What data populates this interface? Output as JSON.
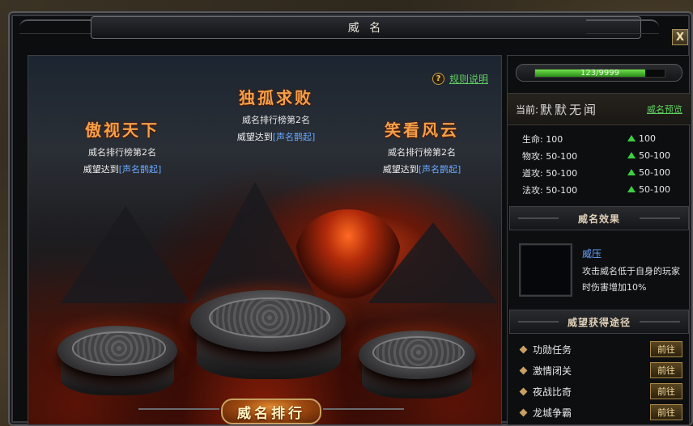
{
  "window": {
    "title": "威 名",
    "close_label": "X"
  },
  "help": {
    "icon_label": "?",
    "rules_link": "规则说明"
  },
  "ranks": [
    {
      "name": "傲视天下",
      "rank_text": "威名排行榜第2名",
      "req_prefix": "威望达到",
      "req_value": "[声名鹊起]"
    },
    {
      "name": "独孤求败",
      "rank_text": "威名排行榜第2名",
      "req_prefix": "威望达到",
      "req_value": "[声名鹊起]"
    },
    {
      "name": "笑看风云",
      "rank_text": "威名排行榜第2名",
      "req_prefix": "威望达到",
      "req_value": "[声名鹊起]"
    }
  ],
  "rank_button": "威名排行",
  "exp": {
    "text": "123/9999",
    "fill_fraction": 0.85
  },
  "current": {
    "label": "当前:",
    "title": "默默无闻",
    "preview_link": "威名预览"
  },
  "stats": [
    {
      "name": "生命: 100",
      "bonus": "100"
    },
    {
      "name": "物攻: 50-100",
      "bonus": "50-100"
    },
    {
      "name": "道攻: 50-100",
      "bonus": "50-100"
    },
    {
      "name": "法攻: 50-100",
      "bonus": "50-100"
    }
  ],
  "effect": {
    "section_title": "威名效果",
    "name": "威压",
    "description": "攻击威名低于自身的玩家时伤害增加10%"
  },
  "ways": {
    "section_title": "威望获得途径",
    "items": [
      {
        "label": "功勋任务",
        "button": "前往"
      },
      {
        "label": "激情闭关",
        "button": "前往"
      },
      {
        "label": "夜战比奇",
        "button": "前往"
      },
      {
        "label": "龙城争霸",
        "button": "前往"
      }
    ]
  },
  "colors": {
    "accent_orange": "#f3a04a",
    "link_green": "#5fd05f",
    "value_blue": "#6aa8ff",
    "arrow_green": "#3ad040"
  }
}
